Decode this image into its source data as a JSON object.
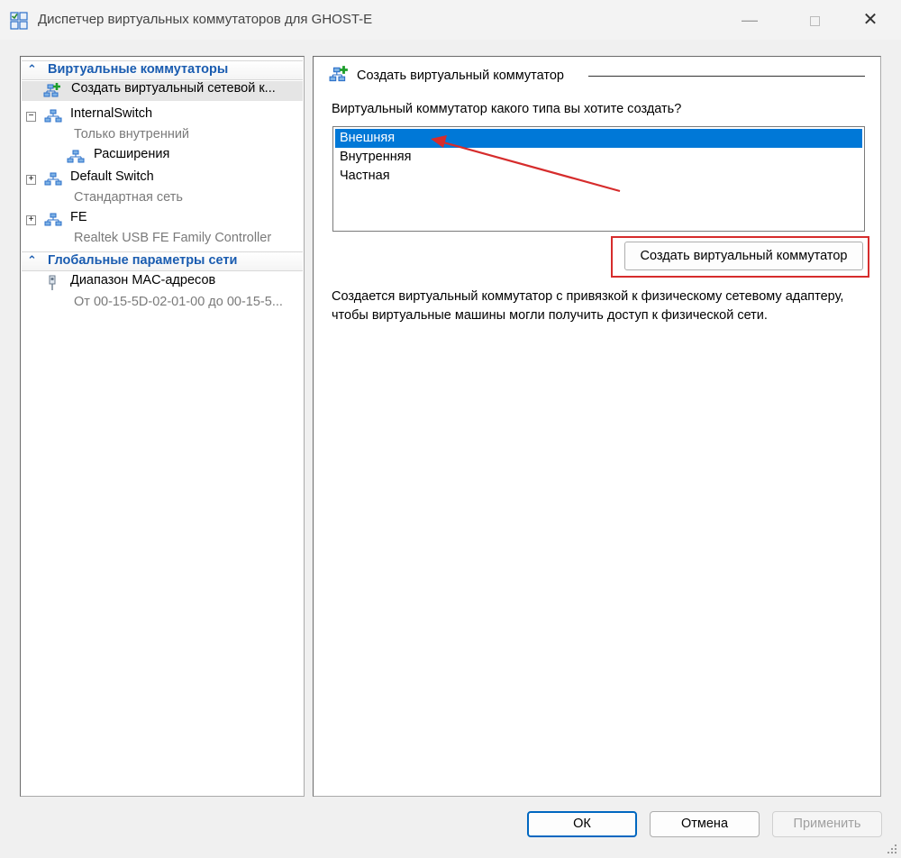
{
  "window": {
    "title": "Диспетчер виртуальных коммутаторов для GHOST-E",
    "app_icon": "virtual-switch-manager-icon",
    "controls": {
      "minimize": "—",
      "close": "✕"
    }
  },
  "sidebar": {
    "sections": [
      {
        "label": "Виртуальные коммутаторы",
        "icon": "collapse-chevron-icon"
      },
      {
        "label": "Глобальные параметры сети",
        "icon": "collapse-chevron-icon"
      }
    ],
    "items": [
      {
        "label": "Создать виртуальный сетевой к...",
        "icon": "add-network-icon"
      },
      {
        "label": "InternalSwitch",
        "sub": "Только внутренний",
        "expander": "−",
        "icon": "network-switch-icon"
      },
      {
        "label": "Расширения",
        "icon": "network-switch-icon"
      },
      {
        "label": "Default Switch",
        "sub": "Стандартная сеть",
        "expander": "+",
        "icon": "network-switch-icon"
      },
      {
        "label": "FE",
        "sub": "Realtek USB FE Family Controller",
        "expander": "+",
        "icon": "network-switch-icon"
      },
      {
        "label": "Диапазон MAC-адресов",
        "sub": "От 00-15-5D-02-01-00 до 00-15-5...",
        "icon": "network-adapter-icon"
      }
    ]
  },
  "main": {
    "group_title": "Создать виртуальный коммутатор",
    "question": "Виртуальный коммутатор какого типа вы хотите создать?",
    "options": [
      "Внешняя",
      "Внутренняя",
      "Частная"
    ],
    "selected_option": "Внешняя",
    "create_button": "Создать виртуальный коммутатор",
    "description": "Создается виртуальный коммутатор с привязкой к физическому сетевому адаптеру, чтобы виртуальные машины могли получить доступ к физической сети."
  },
  "footer": {
    "ok_label": "ОК",
    "cancel_label": "Отмена",
    "apply_label": "Применить"
  },
  "annotation_color": "#d62c2c",
  "accent_color": "#0078d7"
}
